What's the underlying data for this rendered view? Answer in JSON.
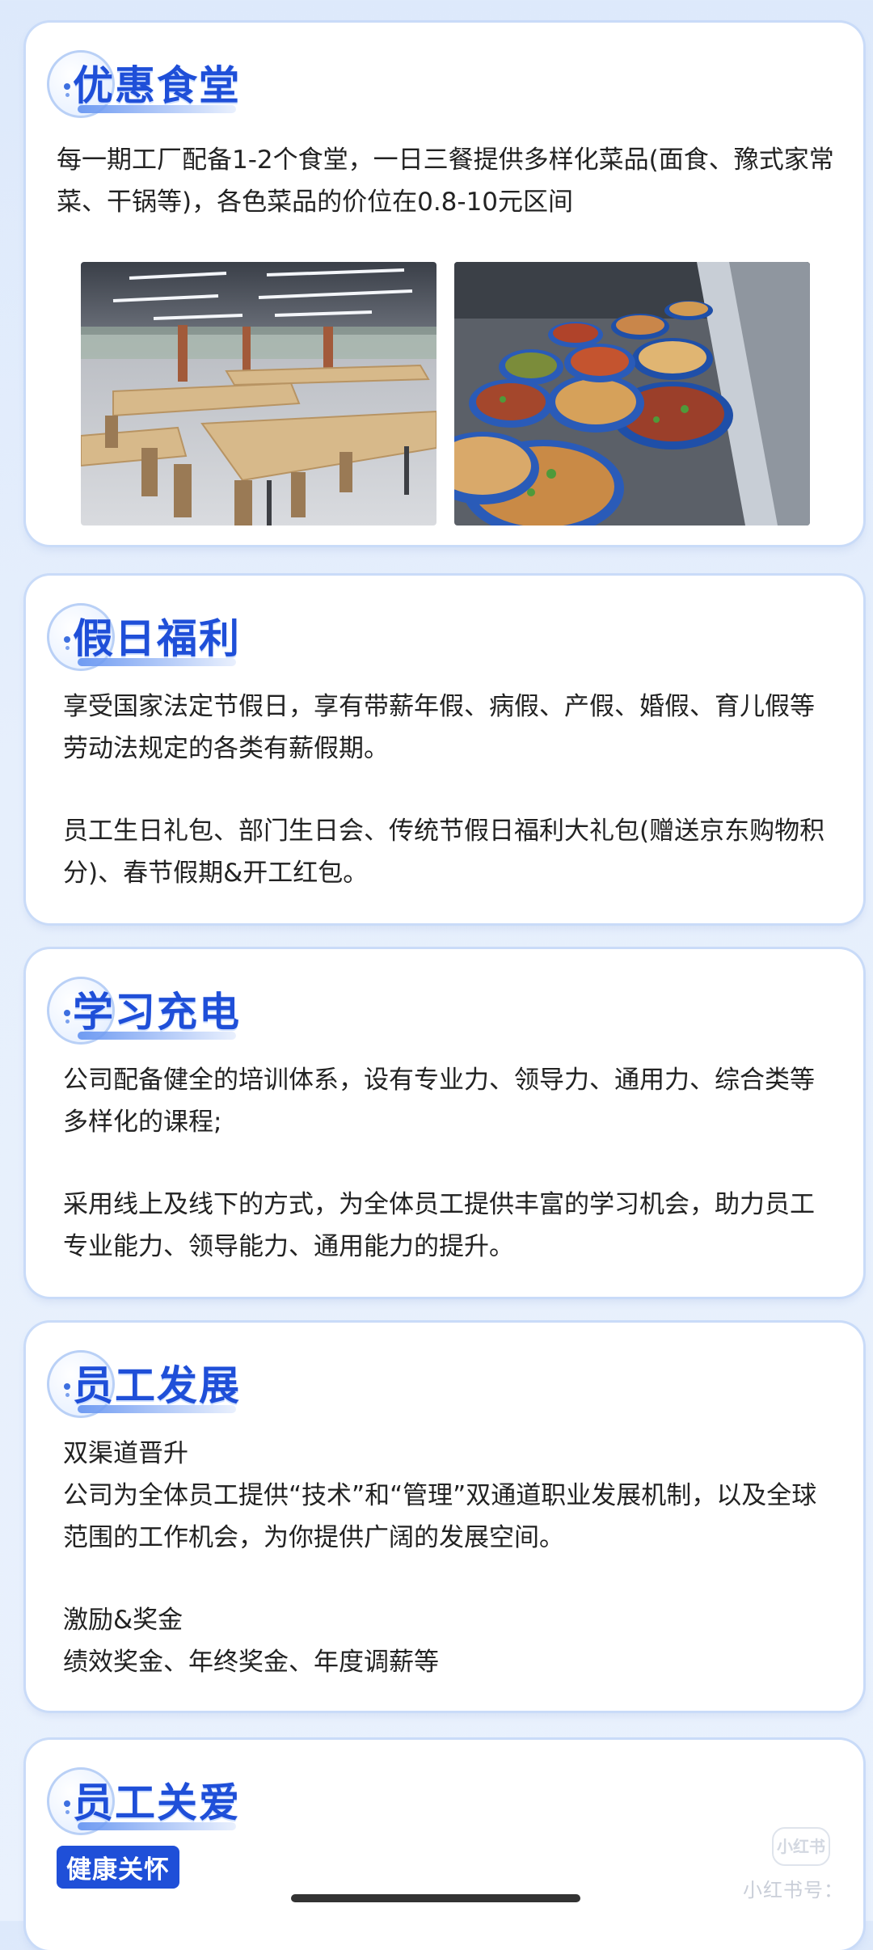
{
  "sections": [
    {
      "title": "优惠食堂",
      "paragraphs": [
        "每一期工厂配备1-2个食堂，一日三餐提供多样化菜品(面食、豫式家常菜、干锅等)，各色菜品的价位在0.8-10元区间"
      ]
    },
    {
      "title": "假日福利",
      "paragraphs": [
        "享受国家法定节假日，享有带薪年假、病假、产假、婚假、育儿假等劳动法规定的各类有薪假期。",
        "员工生日礼包、部门生日会、传统节假日福利大礼包(赠送京东购物积分)、春节假期&开工红包。"
      ]
    },
    {
      "title": "学习充电",
      "paragraphs": [
        "公司配备健全的培训体系，设有专业力、领导力、通用力、综合类等多样化的课程;",
        "采用线上及线下的方式，为全体员工提供丰富的学习机会，助力员工专业能力、领导能力、通用能力的提升。"
      ]
    },
    {
      "title": "员工发展",
      "paragraphs": [
        "双渠道晋升",
        "公司为全体员工提供“技术”和“管理”双通道职业发展机制，以及全球范围的工作机会，为你提供广阔的发展空间。",
        "激励&奖金",
        "绩效奖金、年终奖金、年度调薪等"
      ]
    },
    {
      "title": "员工关爱",
      "badge": "健康关怀"
    }
  ],
  "watermark": "小红书号：",
  "watermark_logo": "小红书",
  "colors": {
    "accent": "#1f4fd8",
    "card": "#ffffff",
    "background": "#e3edfc"
  }
}
